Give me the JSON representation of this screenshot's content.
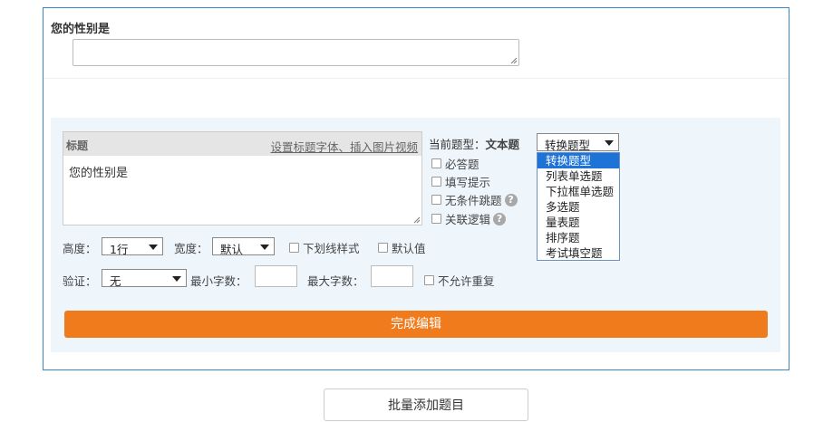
{
  "question": {
    "title": "您的性别是"
  },
  "editor": {
    "title_label": "标题",
    "title_link": "设置标题字体、插入图片视频",
    "title_text": "您的性别是",
    "current_type_label": "当前题型：",
    "current_type_value": "文本题",
    "convert_select_value": "转换题型",
    "convert_options": [
      "转换题型",
      "列表单选题",
      "下拉框单选题",
      "多选题",
      "量表题",
      "排序题",
      "考试填空题"
    ],
    "checkboxes": {
      "required": "必答题",
      "hint": "填写提示",
      "unconditional_jump": "无条件跳题",
      "linked_logic": "关联逻辑"
    },
    "help_glyph": "?",
    "height_label": "高度：",
    "height_value": "1行",
    "width_label": "宽度：",
    "width_value": "默认",
    "underline_style": "下划线样式",
    "default_value": "默认值",
    "validate_label": "验证：",
    "validate_value": "无",
    "min_chars_label": "最小字数：",
    "max_chars_label": "最大字数：",
    "no_duplicate": "不允许重复",
    "done_button": "完成编辑"
  },
  "batch_button": "批量添加题目",
  "colors": {
    "frame_border": "#3a87c8",
    "editor_bg": "#eef6fc",
    "primary_button": "#f07b1d",
    "dropdown_highlight": "#1e73d6"
  }
}
